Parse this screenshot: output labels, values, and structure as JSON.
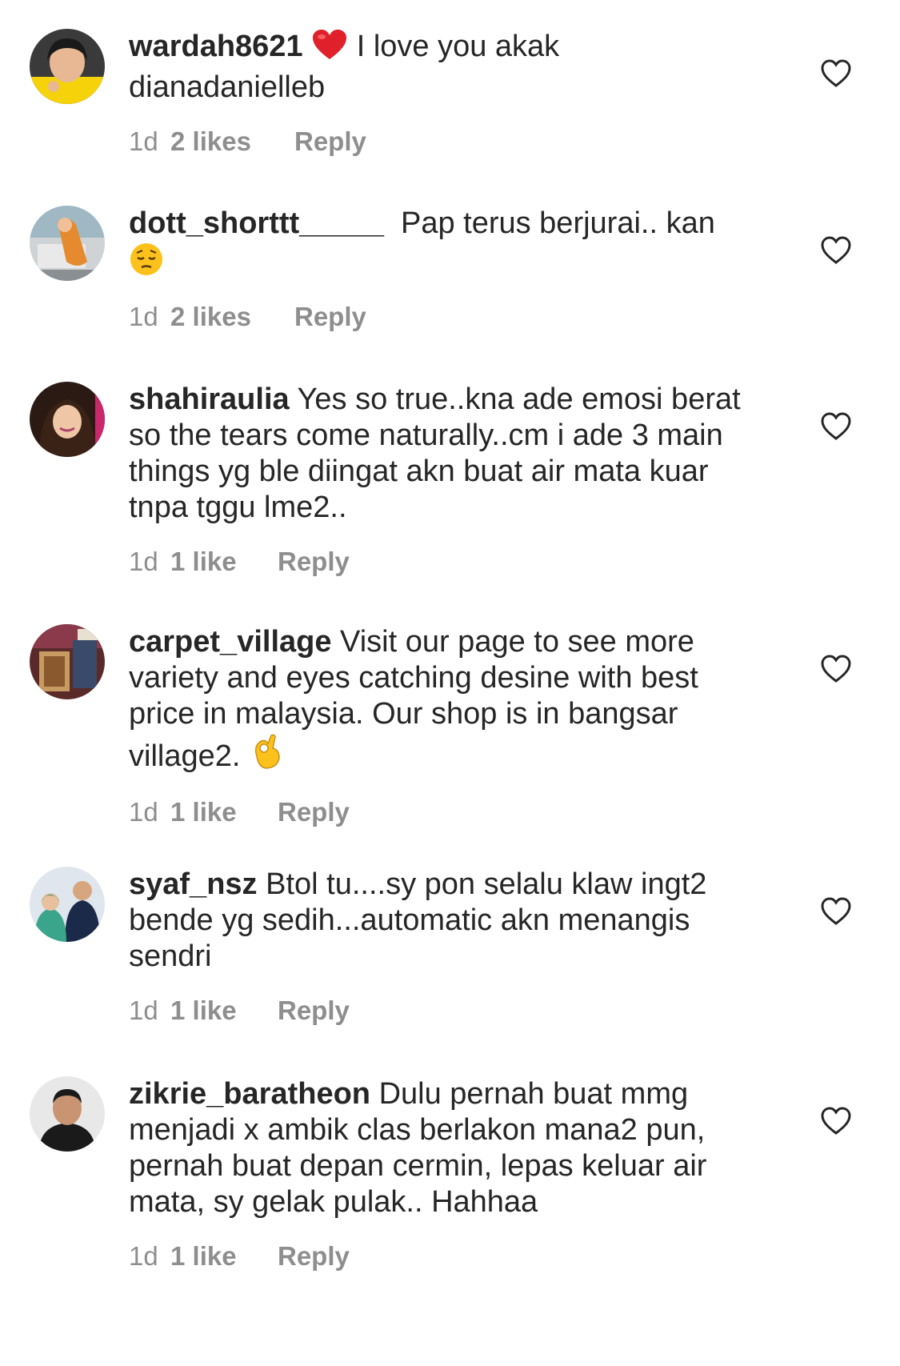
{
  "comments": [
    {
      "username": "wardah8621",
      "text_before_emoji": "",
      "emoji": "heart-emoji",
      "text": "I love you akak dianadanielleb",
      "time": "1d",
      "likes": "2 likes",
      "reply": "Reply"
    },
    {
      "username": "dott_shorttt_____",
      "text": "Pap terus berjurai.. kan",
      "emoji": "pensive-face-emoji",
      "time": "1d",
      "likes": "2 likes",
      "reply": "Reply"
    },
    {
      "username": "shahiraulia",
      "text": "Yes so true..kna ade emosi berat so the tears come naturally..cm i ade 3 main things yg ble diingat akn buat air mata kuar tnpa tggu lme2..",
      "time": "1d",
      "likes": "1 like",
      "reply": "Reply"
    },
    {
      "username": "carpet_village",
      "text": "Visit our page to see more variety and eyes catching desine with best price in malaysia. Our shop is in bangsar village2.",
      "emoji": "ok-hand-emoji",
      "time": "1d",
      "likes": "1 like",
      "reply": "Reply"
    },
    {
      "username": "syaf_nsz",
      "text": "Btol tu....sy pon selalu klaw ingt2 bende yg sedih...automatic akn menangis sendri",
      "time": "1d",
      "likes": "1 like",
      "reply": "Reply"
    },
    {
      "username": "zikrie_baratheon",
      "text": "Dulu pernah buat mmg menjadi x ambik clas berlakon mana2 pun, pernah buat depan cermin, lepas keluar air mata, sy gelak pulak.. Hahhaa",
      "time": "1d",
      "likes": "1 like",
      "reply": "Reply"
    }
  ],
  "icons": {
    "like": "heart-outline-icon"
  },
  "colors": {
    "text": "#262626",
    "meta": "#8e8e8e",
    "heart_emoji": "#e0202a"
  }
}
